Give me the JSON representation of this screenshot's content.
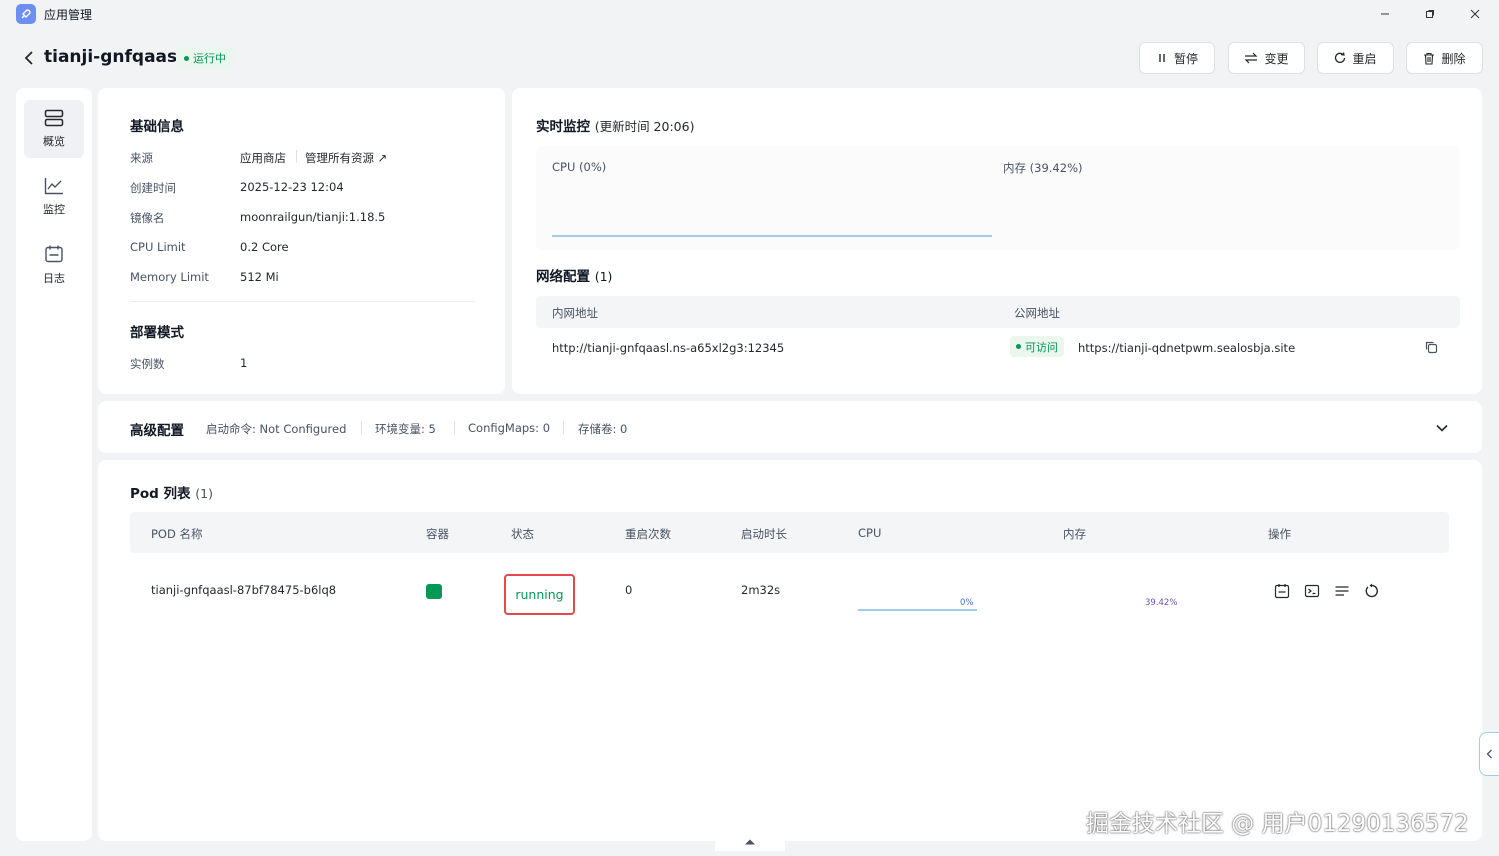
{
  "window": {
    "title": "应用管理"
  },
  "header": {
    "app_name": "tianji-gnfqaasl",
    "status": "运行中",
    "buttons": {
      "pause": "暂停",
      "change": "变更",
      "restart": "重启",
      "delete": "删除"
    }
  },
  "sidebar": {
    "items": [
      {
        "label": "概览",
        "icon": "overview-icon"
      },
      {
        "label": "监控",
        "icon": "chart-icon"
      },
      {
        "label": "日志",
        "icon": "logs-icon"
      }
    ]
  },
  "basic": {
    "title": "基础信息",
    "rows": [
      {
        "key": "来源",
        "value": "应用商店"
      },
      {
        "key": "创建时间",
        "value": "2025-12-23 12:04"
      },
      {
        "key": "镜像名",
        "value": "moonrailgun/tianji:1.18.5"
      },
      {
        "key": "CPU Limit",
        "value": "0.2 Core"
      },
      {
        "key": "Memory Limit",
        "value": "512 Mi"
      }
    ],
    "manage_link": "管理所有资源",
    "deploy_title": "部署模式",
    "instances_key": "实例数",
    "instances_value": "1"
  },
  "monitor": {
    "title": "实时监控",
    "update_time": "(更新时间  20:06)",
    "cpu_label": "CPU  (0%)",
    "mem_label": "内存  (39.42%)"
  },
  "network": {
    "title": "网络配置",
    "count": "(1)",
    "col_internal": "内网地址",
    "col_public": "公网地址",
    "internal": "http://tianji-gnfqaasl.ns-a65xl2g3:12345",
    "accessible": "可访问",
    "public": "https://tianji-qdnetpwm.sealosbja.site"
  },
  "advanced": {
    "title": "高级配置",
    "items": [
      "启动命令: Not Configured",
      "环境变量: 5",
      "ConfigMaps: 0",
      "存储卷: 0"
    ]
  },
  "pods": {
    "title": "Pod 列表",
    "count": "(1)",
    "columns": [
      "POD 名称",
      "容器",
      "状态",
      "重启次数",
      "启动时长",
      "CPU",
      "内存",
      "操作"
    ],
    "rows": [
      {
        "name": "tianji-gnfqaasl-87bf78475-b6lq8",
        "status": "running",
        "restarts": "0",
        "uptime": "2m32s",
        "cpu": "0%",
        "mem": "39.42%"
      }
    ]
  },
  "watermark": "掘金技术社区 @ 用户01290136572",
  "colors": {
    "accent": "#039855",
    "status_box": "#e5484d",
    "line": "#9fcdea"
  }
}
